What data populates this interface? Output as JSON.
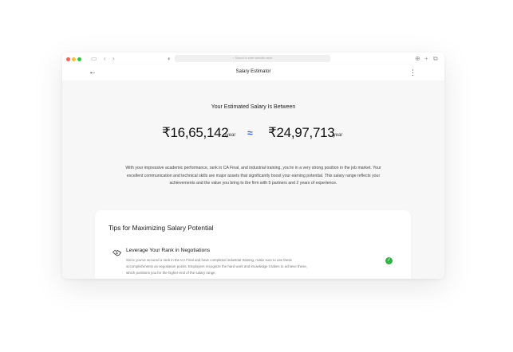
{
  "browser": {
    "url_placeholder": "Search or enter website name"
  },
  "appbar": {
    "back_icon": "arrow-left-icon",
    "title": "Salary Estimator",
    "menu_icon": "more-vertical-icon"
  },
  "estimate": {
    "heading": "Your Estimated Salary Is Between",
    "min_amount": "₹16,65,142",
    "min_period": "/year",
    "approx_symbol": "≈",
    "max_amount": "₹24,97,713",
    "max_period": "/year",
    "description": "With your impressive academic performance, rank in CA Final, and industrial training, you're in a very strong position in the job market. Your excellent communication and technical skills are major assets that significantly boost your earning potential. This salary range reflects your achievements and the value you bring to the firm with 5 partners and 2 years of experience."
  },
  "tips": {
    "title": "Tips for Maximizing Salary Potential",
    "items": [
      {
        "icon": "handshake-icon",
        "title": "Leverage Your Rank in Negotiations",
        "description": "Since you've secured a rank in the CA Final and have completed industrial training, make sure to use these accomplishments as negotiation points. Employers recognize the hard work and knowledge it takes to achieve these, which positions you for the higher-end of the salary range.",
        "status_icon": "check-circle-icon"
      }
    ]
  },
  "colors": {
    "accent": "#3b5bdb",
    "success": "#2fb344"
  }
}
